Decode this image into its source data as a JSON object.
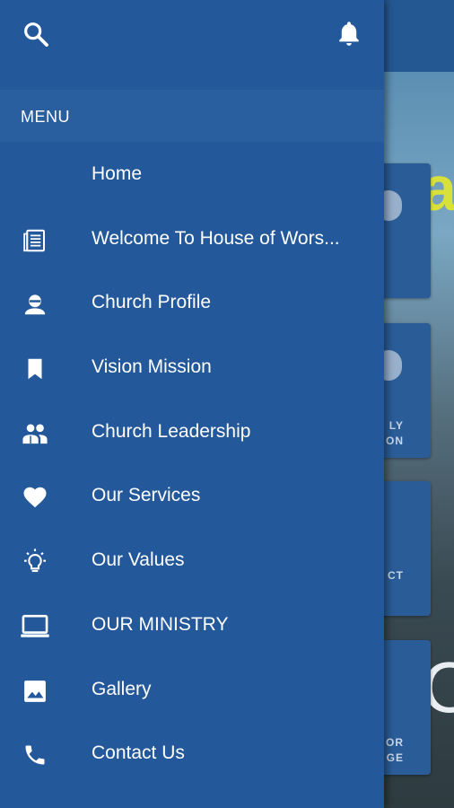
{
  "drawer": {
    "menu_header": "MENU",
    "top_icons": {
      "search": "search-icon",
      "notifications": "bell-icon"
    },
    "items": [
      {
        "label": "Home",
        "icon": ""
      },
      {
        "label": "Welcome To House of Wors...",
        "icon": "newspaper-icon"
      },
      {
        "label": "Church Profile",
        "icon": "person-icon"
      },
      {
        "label": "Vision Mission",
        "icon": "bookmark-icon"
      },
      {
        "label": "Church Leadership",
        "icon": "people-icon"
      },
      {
        "label": "Our Services",
        "icon": "heart-icon"
      },
      {
        "label": "Our Values",
        "icon": "lightbulb-icon"
      },
      {
        "label": "OUR MINISTRY",
        "icon": "laptop-icon"
      },
      {
        "label": "Gallery",
        "icon": "image-icon"
      },
      {
        "label": "Contact Us",
        "icon": "phone-icon"
      }
    ]
  },
  "background": {
    "tiles": [
      {
        "line1": "",
        "line2": ""
      },
      {
        "line1": "LY",
        "line2": "ON"
      },
      {
        "line1": "",
        "line2": "CT"
      },
      {
        "line1": "OR",
        "line2": "GE"
      }
    ]
  },
  "colors": {
    "drawer": "#23589a",
    "header_band": "#2a5f9f",
    "text": "#ffffff"
  }
}
